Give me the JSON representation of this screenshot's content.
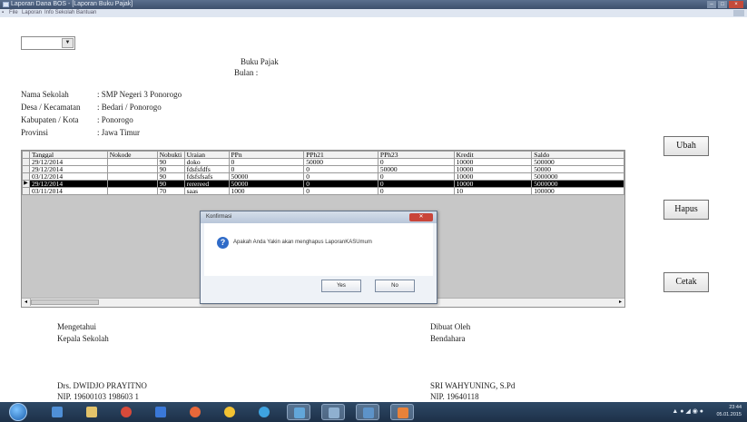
{
  "window": {
    "title": "Laporan Dana BOS - [Laporan Buku Pajak]",
    "menu": [
      "File",
      "Laporan",
      "Info Sekolah",
      "Bantuan"
    ]
  },
  "report": {
    "heading": "Buku Pajak",
    "bulan_label": "Bulan :",
    "info": [
      {
        "label": "Nama Sekolah",
        "value": ": SMP Negeri 3 Ponorogo"
      },
      {
        "label": "Desa / Kecamatan",
        "value": ": Bedari / Ponorogo"
      },
      {
        "label": "Kabupaten / Kota",
        "value": ": Ponorogo"
      },
      {
        "label": "Provinsi",
        "value": ": Jawa Timur"
      }
    ]
  },
  "grid": {
    "columns": [
      "Tanggal",
      "Nokode",
      "Nobukti",
      "Uraian",
      "PPn",
      "PPh21",
      "PPh23",
      "Kredit",
      "Saldo"
    ],
    "rows": [
      [
        "29/12/2014",
        "",
        "90",
        "doko",
        "0",
        "50000",
        "0",
        "10000",
        "500000"
      ],
      [
        "29/12/2014",
        "",
        "90",
        "fdsfsfdfs",
        "0",
        "0",
        "50000",
        "10000",
        "50000"
      ],
      [
        "03/12/2014",
        "",
        "90",
        "fdsfsfsafs",
        "50000",
        "0",
        "0",
        "10000",
        "5000000"
      ],
      [
        "29/12/2014",
        "",
        "90",
        "rerereed",
        "50000",
        "0",
        "0",
        "10000",
        "5000000"
      ],
      [
        "03/11/2014",
        "",
        "70",
        "saas",
        "1000",
        "0",
        "0",
        "10",
        "100000"
      ]
    ],
    "selected_row": 3
  },
  "buttons": {
    "ubah": "Ubah",
    "hapus": "Hapus",
    "cetak": "Cetak"
  },
  "dialog": {
    "title": "Konfirmasi",
    "message": "Apakah Anda Yakin akan menghapus LaporanKASUmum",
    "yes": "Yes",
    "no": "No"
  },
  "signatures": {
    "left": {
      "line1": "Mengetahui",
      "line2": "Kepala Sekolah",
      "name": "Drs. DWIDJO PRAYITNO",
      "nip": "NIP. 19600103 198603 1"
    },
    "right": {
      "line1": "Dibuat Oleh",
      "line2": "Bendahara",
      "name": "SRI WAHYUNING, S.Pd",
      "nip": "NIP. 19640118"
    }
  },
  "taskbar": {
    "clock_time": "23:44",
    "clock_date": "05.01.2015"
  }
}
